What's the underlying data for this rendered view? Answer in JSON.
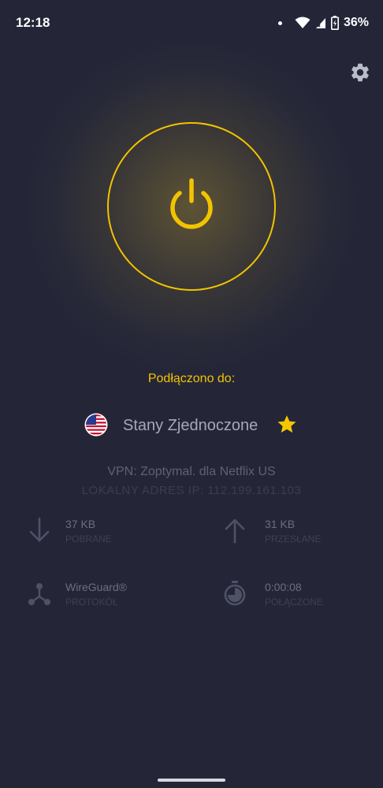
{
  "status_bar": {
    "time": "12:18",
    "battery": "36%"
  },
  "icons": {
    "settings": "gear-icon",
    "power": "power-icon",
    "flag": "us-flag-icon",
    "favorite": "star-icon",
    "download": "arrow-down-icon",
    "upload": "arrow-up-icon",
    "protocol": "network-icon",
    "duration": "stopwatch-icon"
  },
  "colors": {
    "background": "#242638",
    "accent": "#f2c300"
  },
  "connection": {
    "status_label": "Podłączono do:",
    "country": "Stany Zjednoczone",
    "vpn_line": "VPN:  Zoptymal. dla Netflix US",
    "local_ip_line": "LOKALNY ADRES IP:  112.199.161.103"
  },
  "stats": {
    "download": {
      "value": "37 KB",
      "label": "POBRANE"
    },
    "upload": {
      "value": "31 KB",
      "label": "PRZESŁANE"
    },
    "protocol": {
      "value": "WireGuard®",
      "label": "PROTOKÓŁ"
    },
    "duration": {
      "value": "0:00:08",
      "label": "POŁĄCZONE"
    }
  }
}
